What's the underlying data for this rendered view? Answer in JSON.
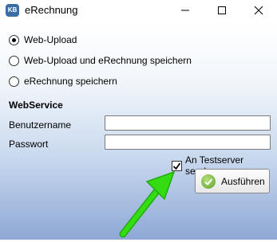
{
  "window": {
    "icon_text": "KB",
    "title": "eRechnung"
  },
  "options": [
    {
      "label": "Web-Upload",
      "selected": true
    },
    {
      "label": "Web-Upload und eRechnung speichern",
      "selected": false
    },
    {
      "label": "eRechnung speichern",
      "selected": false
    }
  ],
  "webservice": {
    "title": "WebService",
    "username_label": "Benutzername",
    "username_value": "",
    "password_label": "Passwort",
    "password_value": ""
  },
  "testserver": {
    "label": "An Testserver senden",
    "checked": true
  },
  "run_button": {
    "label": "Ausführen"
  },
  "colors": {
    "arrow": "#33dd11",
    "ok_icon": "#5aa02c"
  }
}
